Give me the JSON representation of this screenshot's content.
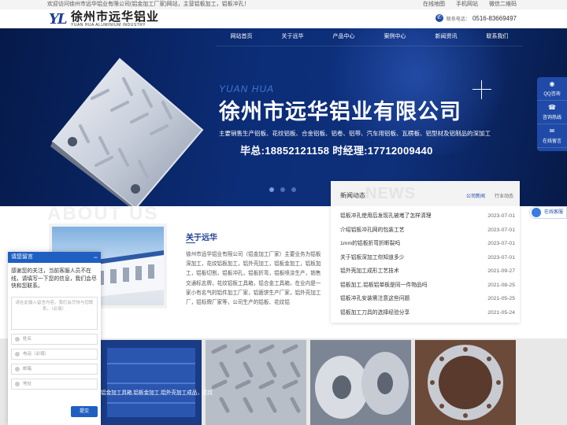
{
  "topbar": {
    "welcome": "欢迎访问徐州市远华铝业有限公司(铝金加工厂家)网站，主营铝板加工，铝板冲孔！",
    "links": [
      "在线地图",
      "手机网站",
      "微信二维码"
    ]
  },
  "header": {
    "logo_mark": "YL",
    "logo_cn": "徐州市远华铝业",
    "logo_en": "YUAN HUA ALUMINIUM INDUSTRY",
    "phone_label": "联系电话：",
    "phone": "0516-83669497"
  },
  "nav": [
    "网站首页",
    "关于远华",
    "产品中心",
    "案例中心",
    "新闻资讯",
    "联系我们"
  ],
  "hero": {
    "en": "YUAN HUA",
    "cn": "徐州市远华铝业有限公司",
    "sub": "主要销售生产铝板、花纹铝板、合金铝板、铝卷、铝带、汽车用铝板、瓦楞板、铝型材及铝制品的深加工",
    "contact": "毕总:18852121158    时经理:17712009440"
  },
  "news": {
    "title": "新闻动态",
    "bg_text": "NEWS",
    "tabs": [
      "公司新闻",
      "行业动态"
    ],
    "items": [
      {
        "title": "铝板冲孔使用后发现孔被堵了怎样清理",
        "date": "2023-07-01"
      },
      {
        "title": "介绍铝板冲孔网的包装工艺",
        "date": "2023-07-01"
      },
      {
        "title": "1mm的铝板折弯折断裂吗",
        "date": "2023-07-01"
      },
      {
        "title": "关于铝板深加工你知道多少",
        "date": "2023-07-01"
      },
      {
        "title": "铝外壳加工成形工艺技术",
        "date": "2021-09-27"
      },
      {
        "title": "铝板加工,铝板铝单板是同一件物品吗",
        "date": "2021-08-25"
      },
      {
        "title": "铝板冲孔安装需注意这些问题",
        "date": "2021-05-25"
      },
      {
        "title": "铝板加工刀具的选择经验分享",
        "date": "2021-05-24"
      }
    ]
  },
  "about": {
    "bg_text": "ABOUT US",
    "title": "关于远华",
    "text": "徐州市远华铝业有限公司（铝金加工厂家）主要业务为铝板深加工，花纹铝板加工，铝外壳加工，铝板金加工，铝板加工，铝板切割，铝板冲孔，铝板折弯，铝板喷涂生产，销售交通标志牌，花纹铝板工具箱，铝合金工具箱，在业内是一家小有名气的铝件加工厂家，铝面饼生产厂家，铝外壳加工厂，铝标牌厂家等，公司生产的铝板、花纹铝"
  },
  "chat": {
    "title": "请您留言",
    "minimize": "−",
    "message": "感谢您的关注，当前客服人员不在线，请填写一下您的信息，我们会尽快和您联系。",
    "textarea_placeholder": "请在此输入留言内容，我们会尽快与您联系。（必填）",
    "fields": [
      "姓名",
      "电话（必填）",
      "邮箱",
      "地址"
    ],
    "submit": "提交",
    "side_text": "铝金加工具箱,铝板金加工,铝外壳加工成品，花纹"
  },
  "side_float": [
    "QQ咨询",
    "咨询热线",
    "在线留言"
  ],
  "online_label": "在线客服"
}
